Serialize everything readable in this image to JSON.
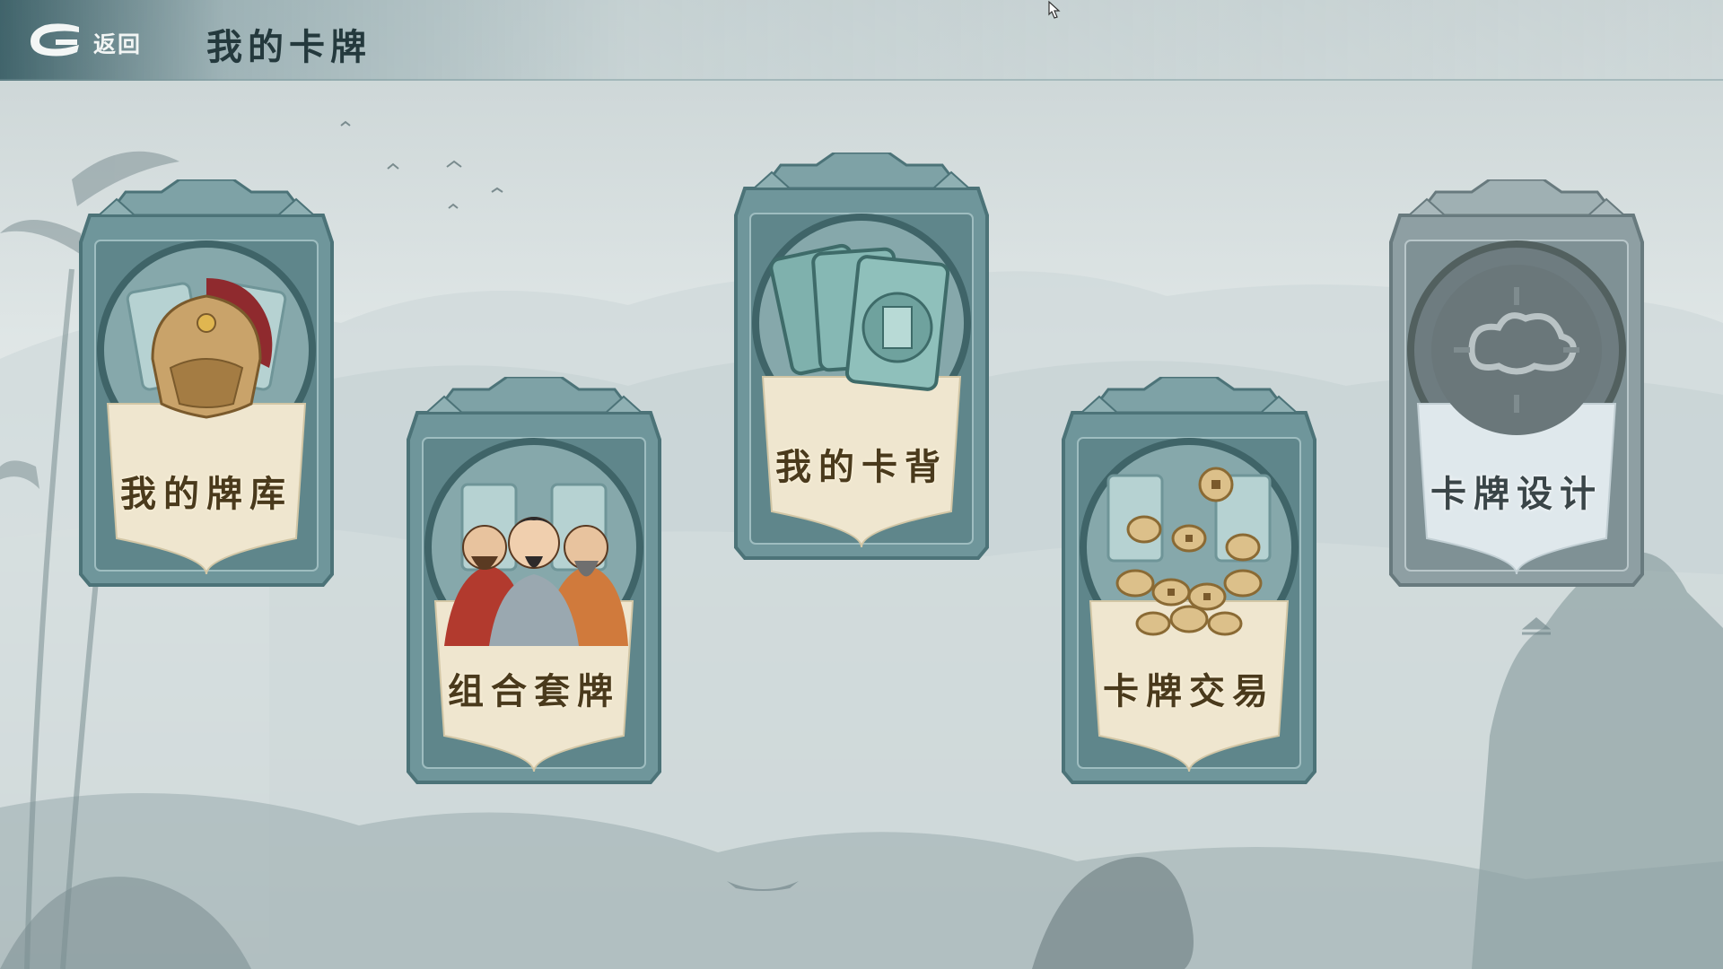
{
  "header": {
    "back_label": "返回",
    "title": "我的卡牌"
  },
  "cards": [
    {
      "label": "我的牌库",
      "icon": "helmet-icon",
      "state": "normal"
    },
    {
      "label": "组合套牌",
      "icon": "heroes-portrait-icon",
      "state": "normal"
    },
    {
      "label": "我的卡背",
      "icon": "card-backs-icon",
      "state": "normal"
    },
    {
      "label": "卡牌交易",
      "icon": "coins-icon",
      "state": "normal"
    },
    {
      "label": "卡牌设计",
      "icon": "cloud-emblem-icon",
      "state": "locked"
    }
  ],
  "colors": {
    "frame": "#6f969b",
    "frame_dark": "#4c7378",
    "banner": "#efe6cf",
    "locked_frame": "#8e9fa3"
  }
}
